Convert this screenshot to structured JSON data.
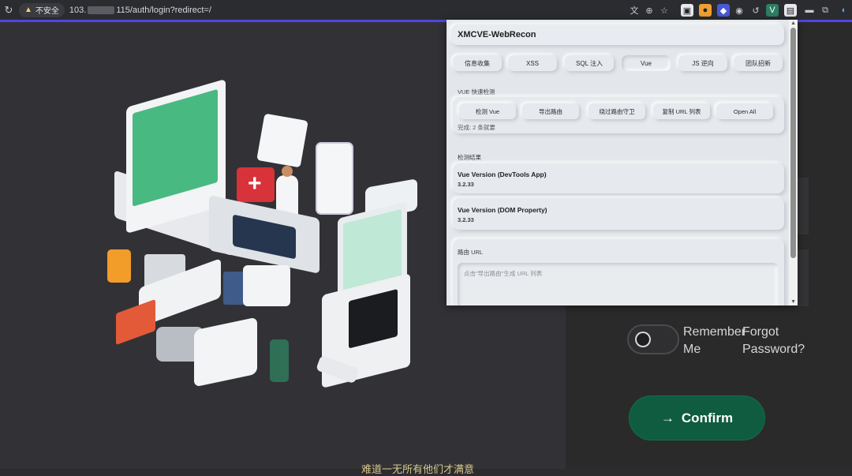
{
  "browser": {
    "security_label": "不安全",
    "url_prefix": "103.",
    "url_suffix": "115/auth/login?redirect=/"
  },
  "extension_popup": {
    "title": "XMCVE-WebRecon",
    "tabs": [
      "信息收集",
      "XSS",
      "SQL 注入",
      "Vue",
      "JS 逆向",
      "团队招新"
    ],
    "active_tab": "Vue",
    "vue_section_label": "VUE 快速检测",
    "buttons": [
      "检测 Vue",
      "导出路由",
      "绕过路由守卫",
      "复制 URL 列表",
      "Open All"
    ],
    "status_text": "完成: 2 条就要",
    "results_label": "检测结果",
    "results": [
      {
        "title": "Vue Version (DevTools App)",
        "value": "3.2.33"
      },
      {
        "title": "Vue Version (DOM Property)",
        "value": "3.2.33"
      }
    ],
    "route_label": "路由 URL",
    "route_placeholder": "点击\"导出路由\"生成 URL 列表"
  },
  "login": {
    "remember_label": "Remember Me",
    "remember_line1": "Remember",
    "remember_line2": "Me",
    "forgot_line1": "Forgot",
    "forgot_line2": "Password?",
    "confirm_label": "Confirm",
    "remember_checked": false
  },
  "footer_text": "难道一无所有他们才满意",
  "colors": {
    "accent": "#4f46e5",
    "confirm_button": "#0f5c40",
    "popup_bg": "#e3e6ea",
    "footer_text": "#d8c88a"
  }
}
